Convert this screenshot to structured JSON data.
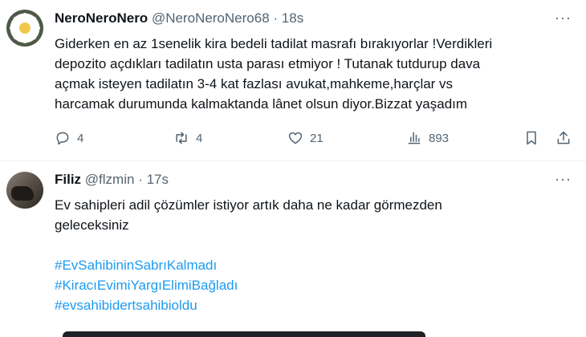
{
  "tweets": [
    {
      "name": "NeroNeroNero",
      "handle": "@NeroNeroNero68",
      "separator": "·",
      "time": "18s",
      "text_lines": [
        "Giderken en az 1senelik kira bedeli tadilat masrafı bırakıyorlar !Verdikleri",
        "depozito açdıkları tadilatın usta parası etmiyor ! Tutanak tutdurup dava",
        "açmak isteyen tadilatın 3-4 kat fazlası avukat,mahkeme,harçlar vs",
        "harcamak durumunda kalmaktanda lânet olsun diyor.Bizzat yaşadım"
      ],
      "actions": {
        "replies": "4",
        "retweets": "4",
        "likes": "21",
        "views": "893"
      },
      "avatar_icon": "daisy-flower-avatar"
    },
    {
      "name": "Filiz",
      "handle": "@flzmin",
      "separator": "·",
      "time": "17s",
      "text_lines": [
        "Ev sahipleri adil çözümler istiyor artık daha ne kadar görmezden",
        "geleceksiniz"
      ],
      "hashtags": [
        "#EvSahibininSabrıKalmadı",
        "#KiracıEvimiYargıElimiBağladı",
        "#evsahibidertsahibioldu"
      ],
      "avatar_icon": "hand-photo-avatar"
    }
  ],
  "more_glyph": "···",
  "colors": {
    "text": "#0f1419",
    "secondary": "#536471",
    "link": "#1d9bf0",
    "divider": "#eff3f4"
  },
  "icons": [
    "reply-icon",
    "retweet-icon",
    "like-icon",
    "views-icon",
    "bookmark-icon",
    "share-icon",
    "more-icon"
  ]
}
